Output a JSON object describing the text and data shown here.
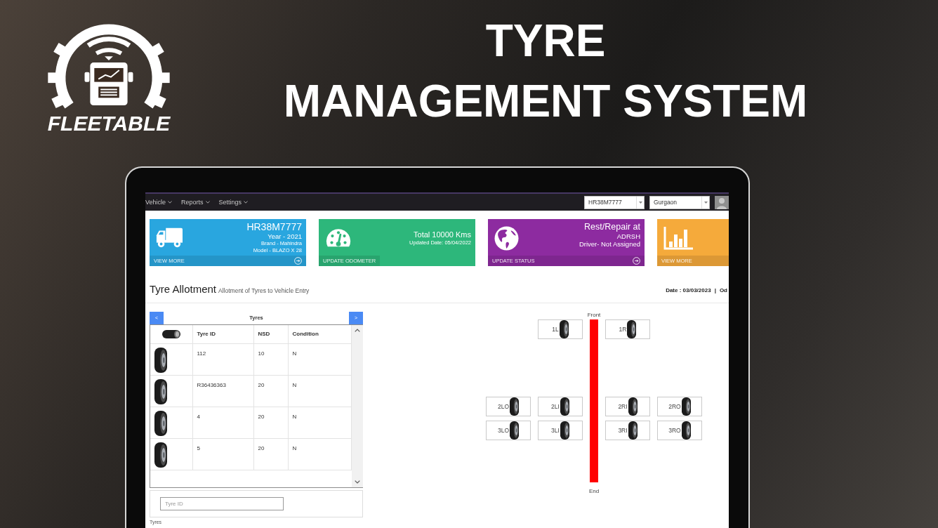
{
  "brand": {
    "name": "FLEETABLE"
  },
  "headline": [
    "TYRE",
    "MANAGEMENT SYSTEM"
  ],
  "app": {
    "nav": {
      "menus": [
        {
          "label": "Vehicle"
        },
        {
          "label": "Reports"
        },
        {
          "label": "Settings"
        }
      ],
      "vehicle_select": "HR38M7777",
      "location_select": "Gurgaon"
    },
    "tiles": [
      {
        "kind": "vehicle",
        "color": "#29a6df",
        "title": "HR38M7777",
        "subtitles": [
          "Year - 2021"
        ],
        "details": [
          "Brand - Mahindra",
          "Model - BLAZO X 28"
        ],
        "footer": "VIEW MORE",
        "arrow": true
      },
      {
        "kind": "odometer",
        "color": "#2db77b",
        "title": "Total 10000 Kms",
        "details": [
          "Updated Date: 05/04/2022"
        ],
        "footer": "UPDATE ODOMETER",
        "arrow": false
      },
      {
        "kind": "status",
        "color": "#8d2ba0",
        "title": "Rest/Repair at",
        "subtitles": [
          "ADRSH",
          "Driver- Not Assigned"
        ],
        "footer": "UPDATE STATUS",
        "arrow": true
      },
      {
        "kind": "reports",
        "color": "#f5aa3b",
        "footer": "VIEW MORE",
        "arrow": false
      }
    ],
    "page_header": {
      "title": "Tyre Allotment",
      "subtitle": "Allotment of Tyres to Vehicle Entry",
      "date": "Date : 03/03/2023",
      "separator": "|",
      "next_item": "Od"
    },
    "tyre_panel": {
      "prev_button": "<",
      "title": "Tyres",
      "next_button": ">",
      "columns": [
        "Tyre ID",
        "NSD",
        "Condition"
      ],
      "rows": [
        {
          "tyre_id": "112",
          "nsd": "10",
          "condition": "N"
        },
        {
          "tyre_id": "R36436363",
          "nsd": "20",
          "condition": "N"
        },
        {
          "tyre_id": "4",
          "nsd": "20",
          "condition": "N"
        },
        {
          "tyre_id": "5",
          "nsd": "20",
          "condition": "N"
        }
      ],
      "search": {
        "placeholder": "Tyre ID"
      },
      "footer_label": "Tyres"
    },
    "axle_diagram": {
      "front_label": "Front",
      "end_label": "End",
      "axles": [
        {
          "inner_left": "1L",
          "inner_right": "1R"
        },
        {
          "outer_left": "2LO",
          "inner_left": "2LI",
          "inner_right": "2RI",
          "outer_right": "2RO"
        },
        {
          "outer_left": "3LO",
          "inner_left": "3LI",
          "inner_right": "3RI",
          "outer_right": "3RO"
        }
      ]
    }
  }
}
